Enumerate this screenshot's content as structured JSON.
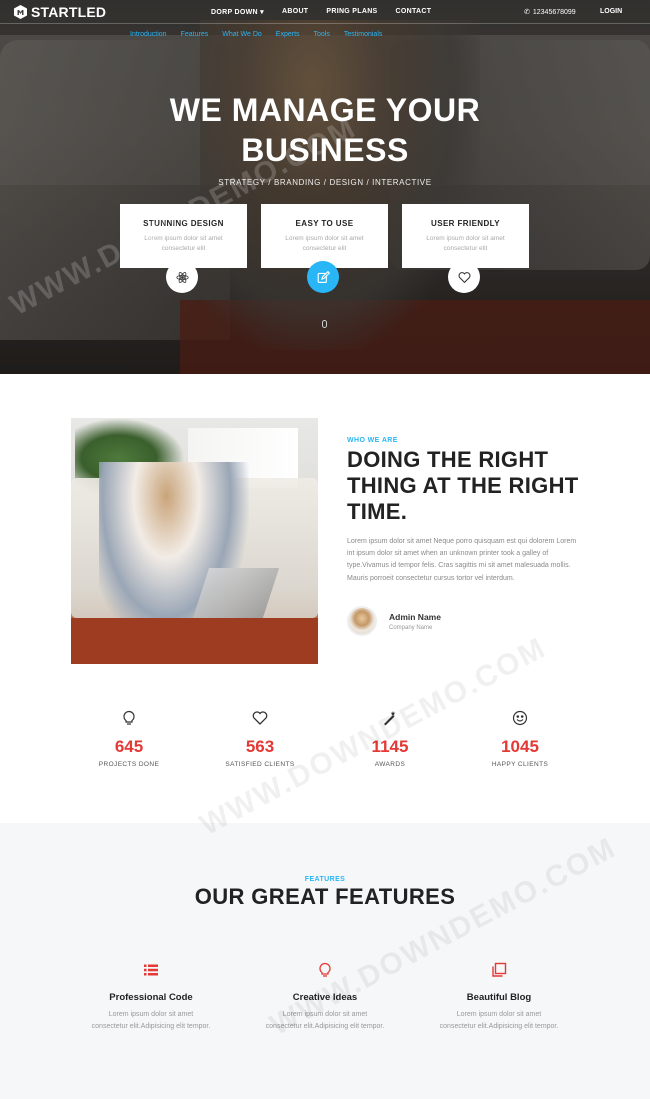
{
  "brand": {
    "name": "STARTLED"
  },
  "nav": {
    "items": [
      "DORP DOWN",
      "ABOUT",
      "PRING PLANS",
      "CONTACT"
    ],
    "phone": "12345678099",
    "login": "LOGIN"
  },
  "subnav": {
    "items": [
      "Introduction",
      "Features",
      "What We Do",
      "Experts",
      "Tools",
      "Testimonials"
    ]
  },
  "hero": {
    "title_line1": "WE MANAGE YOUR",
    "title_line2": "BUSINESS",
    "subtitle": "STRATEGY / BRANDING / DESIGN / INTERACTIVE",
    "cards": [
      {
        "title": "STUNNING DESIGN",
        "text": "Lorem ipsum dolor sit amet consectetur elit",
        "icon": "atom-icon"
      },
      {
        "title": "EASY TO USE",
        "text": "Lorem ipsum dolor sit amet consectetur elit",
        "icon": "edit-icon"
      },
      {
        "title": "USER FRIENDLY",
        "text": "Lorem ipsum dolor sit amet consectetur elit",
        "icon": "heart-icon"
      }
    ]
  },
  "about": {
    "eyebrow": "WHO WE ARE",
    "title": "DOING THE RIGHT THING AT THE RIGHT TIME.",
    "text": "Lorem ipsum dolor sit amet Neque porro quisquam est qui dolorem Lorem int ipsum dolor sit amet when an unknown printer took a galley of type.Vivamus id tempor felis. Cras sagittis mi sit amet malesuada mollis. Mauris porroeit consectetur cursus tortor vel interdum.",
    "admin_name": "Admin Name",
    "admin_company": "Company Name"
  },
  "stats": [
    {
      "value": "645",
      "label": "PROJECTS DONE",
      "icon": "lightbulb-icon"
    },
    {
      "value": "563",
      "label": "SATISFIED CLIENTS",
      "icon": "heart-icon"
    },
    {
      "value": "1145",
      "label": "AWARDS",
      "icon": "magic-wand-icon"
    },
    {
      "value": "1045",
      "label": "HAPPY CLIENTS",
      "icon": "smile-icon"
    }
  ],
  "features": {
    "eyebrow": "FEATURES",
    "title": "OUR GREAT FEATURES",
    "items": [
      {
        "title": "Professional Code",
        "text_line1": "Lorem ipsum dolor sit amet",
        "text_line2": "consectetur elit.Adipisicing elit tempor.",
        "icon": "list-icon"
      },
      {
        "title": "Creative Ideas",
        "text_line1": "Lorem ipsum dolor sit amet",
        "text_line2": "consectetur elit.Adipisicing elit tempor.",
        "icon": "lightbulb-icon"
      },
      {
        "title": "Beautiful Blog",
        "text_line1": "Lorem ipsum dolor sit amet",
        "text_line2": "consectetur elit.Adipisicing elit tempor.",
        "icon": "copy-icon"
      }
    ]
  },
  "colors": {
    "accent_blue": "#29b6f6",
    "accent_red": "#e53935",
    "dark": "#222222"
  },
  "watermark": "WWW.DOWNDEMO.COM"
}
